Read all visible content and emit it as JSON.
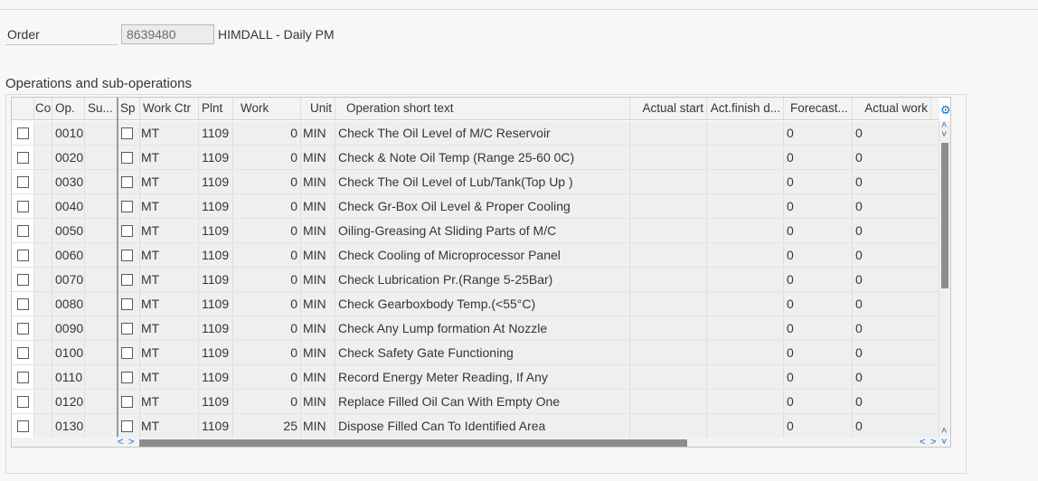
{
  "header": {
    "order_label": "Order",
    "order_value": "8639480",
    "order_description": "HIMDALL - Daily PM"
  },
  "section_title": "Operations and sub-operations",
  "table": {
    "columns": {
      "co": "Co",
      "op": "Op.",
      "su": "Su...",
      "sp": "Sp",
      "work_ctr": "Work Ctr",
      "plnt": "Plnt",
      "work": "Work",
      "unit": "Unit",
      "op_text": "Operation short text",
      "actual_start": "Actual start",
      "act_finish": "Act.finish d...",
      "forecast": "Forecast...",
      "actual_work": "Actual work"
    },
    "rows": [
      {
        "op": "0010",
        "work_ctr": "MT",
        "plnt": "1109",
        "work": "0",
        "unit": "MIN",
        "text": "Check The Oil Level of M/C Reservoir",
        "forecast": "0",
        "actual_work": "0"
      },
      {
        "op": "0020",
        "work_ctr": "MT",
        "plnt": "1109",
        "work": "0",
        "unit": "MIN",
        "text": "Check & Note Oil Temp (Range 25-60 0C)",
        "forecast": "0",
        "actual_work": "0"
      },
      {
        "op": "0030",
        "work_ctr": "MT",
        "plnt": "1109",
        "work": "0",
        "unit": "MIN",
        "text": "Check The Oil Level of Lub/Tank(Top Up )",
        "forecast": "0",
        "actual_work": "0"
      },
      {
        "op": "0040",
        "work_ctr": "MT",
        "plnt": "1109",
        "work": "0",
        "unit": "MIN",
        "text": "Check Gr-Box Oil Level & Proper Cooling",
        "forecast": "0",
        "actual_work": "0"
      },
      {
        "op": "0050",
        "work_ctr": "MT",
        "plnt": "1109",
        "work": "0",
        "unit": "MIN",
        "text": "Oiling-Greasing At Sliding Parts of M/C",
        "forecast": "0",
        "actual_work": "0"
      },
      {
        "op": "0060",
        "work_ctr": "MT",
        "plnt": "1109",
        "work": "0",
        "unit": "MIN",
        "text": "Check Cooling of Microprocessor Panel",
        "forecast": "0",
        "actual_work": "0"
      },
      {
        "op": "0070",
        "work_ctr": "MT",
        "plnt": "1109",
        "work": "0",
        "unit": "MIN",
        "text": "Check Lubrication Pr.(Range 5-25Bar)",
        "forecast": "0",
        "actual_work": "0"
      },
      {
        "op": "0080",
        "work_ctr": "MT",
        "plnt": "1109",
        "work": "0",
        "unit": "MIN",
        "text": "Check Gearboxbody Temp.(<55°C)",
        "forecast": "0",
        "actual_work": "0"
      },
      {
        "op": "0090",
        "work_ctr": "MT",
        "plnt": "1109",
        "work": "0",
        "unit": "MIN",
        "text": "Check Any Lump formation At Nozzle",
        "forecast": "0",
        "actual_work": "0"
      },
      {
        "op": "0100",
        "work_ctr": "MT",
        "plnt": "1109",
        "work": "0",
        "unit": "MIN",
        "text": "Check Safety Gate Functioning",
        "forecast": "0",
        "actual_work": "0"
      },
      {
        "op": "0110",
        "work_ctr": "MT",
        "plnt": "1109",
        "work": "0",
        "unit": "MIN",
        "text": "Record Energy Meter Reading, If Any",
        "forecast": "0",
        "actual_work": "0"
      },
      {
        "op": "0120",
        "work_ctr": "MT",
        "plnt": "1109",
        "work": "0",
        "unit": "MIN",
        "text": "Replace Filled Oil Can With Empty One",
        "forecast": "0",
        "actual_work": "0"
      },
      {
        "op": "0130",
        "work_ctr": "MT",
        "plnt": "1109",
        "work": "25",
        "unit": "MIN",
        "text": "Dispose Filled Can To Identified Area",
        "forecast": "0",
        "actual_work": "0"
      }
    ]
  },
  "icons": {
    "settings": "gear-icon",
    "scroll_up": "chevron-up-icon",
    "scroll_down": "chevron-down-icon",
    "scroll_left": "chevron-left-icon",
    "scroll_right": "chevron-right-icon"
  },
  "colors": {
    "accent": "#0a6ed1",
    "scroll_thumb": "#8c8c8c"
  }
}
